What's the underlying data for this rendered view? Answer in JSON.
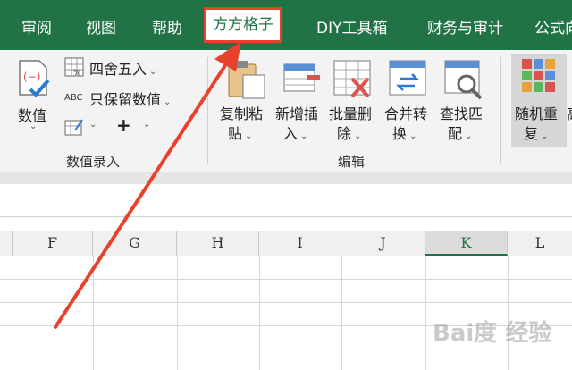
{
  "tabs": [
    {
      "label": "审阅"
    },
    {
      "label": "视图"
    },
    {
      "label": "帮助"
    },
    {
      "label": "方方格子"
    },
    {
      "label": "DIY工具箱"
    },
    {
      "label": "财务与审计"
    },
    {
      "label": "公式向"
    }
  ],
  "active_tab_index": 3,
  "ribbon": {
    "entry_group": {
      "label": "数值录入",
      "value_button": "数值",
      "round_button": "四舍五入",
      "keep_value_button": "只保留数值",
      "keep_value_prefix": "ABC",
      "plus_symbol": "+"
    },
    "edit_group": {
      "label": "编辑",
      "buttons": [
        {
          "line1": "复制粘",
          "line2": "贴"
        },
        {
          "line1": "新增插",
          "line2": "入"
        },
        {
          "line1": "批量删",
          "line2": "除"
        },
        {
          "line1": "合并转",
          "line2": "换"
        },
        {
          "line1": "查找匹",
          "line2": "配"
        }
      ]
    },
    "random_button": {
      "line1": "随机重",
      "line2": "复"
    },
    "overflow_char": "高"
  },
  "columns": [
    "F",
    "G",
    "H",
    "I",
    "J",
    "K",
    "L"
  ],
  "selected_column": "K",
  "watermark": "Bai度 经验",
  "colors": {
    "tab_green": "#217346",
    "highlight_red": "#e8412c",
    "arrow_red": "#e8412c"
  }
}
